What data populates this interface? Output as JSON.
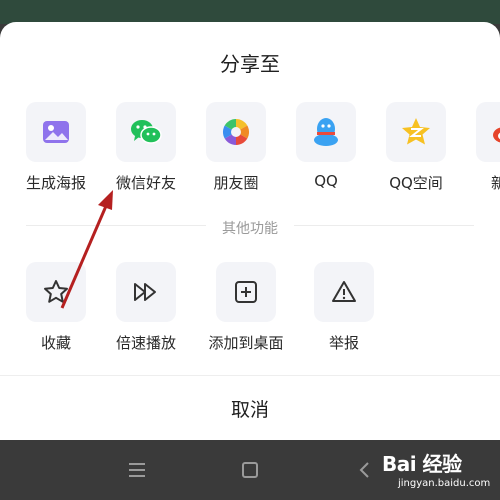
{
  "sheet": {
    "title": "分享至"
  },
  "share_targets": [
    {
      "label": "生成海报",
      "icon": "poster-icon",
      "color": "#8f73ec"
    },
    {
      "label": "微信好友",
      "icon": "wechat-icon",
      "color": "#21c05a"
    },
    {
      "label": "朋友圈",
      "icon": "moments-icon",
      "color": "#f0a020"
    },
    {
      "label": "QQ",
      "icon": "qq-icon",
      "color": "#3aa2f2"
    },
    {
      "label": "QQ空间",
      "icon": "qzone-icon",
      "color": "#f7c122"
    },
    {
      "label": "新浪",
      "icon": "weibo-icon",
      "color": "#e6452c"
    }
  ],
  "other_functions": {
    "section_label": "其他功能",
    "items": [
      {
        "label": "收藏",
        "icon": "star-icon"
      },
      {
        "label": "倍速播放",
        "icon": "fast-forward-icon"
      },
      {
        "label": "添加到桌面",
        "icon": "add-to-desktop-icon"
      },
      {
        "label": "举报",
        "icon": "warning-icon"
      }
    ]
  },
  "cancel_label": "取消",
  "navbar": {
    "icons": [
      "menu-icon",
      "home-square-icon",
      "back-icon"
    ]
  },
  "watermark": {
    "logo_text": "Bai  经验",
    "site": "jingyan.baidu.com"
  },
  "annotation": {
    "icon": "red-arrow-icon",
    "color": "#b52020"
  }
}
